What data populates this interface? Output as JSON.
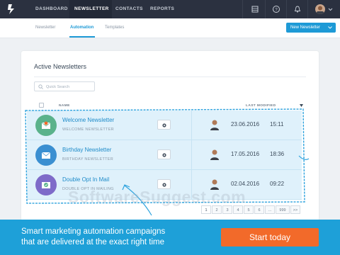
{
  "topnav": {
    "items": [
      {
        "label": "DASHBOARD"
      },
      {
        "label": "NEWSLETTER"
      },
      {
        "label": "CONTACTS"
      },
      {
        "label": "REPORTS"
      }
    ],
    "active_index": 1,
    "icons": [
      "grid-icon",
      "help-icon",
      "bell-icon",
      "avatar",
      "chevron-down-icon"
    ]
  },
  "subnav": {
    "items": [
      {
        "label": "Newsletter"
      },
      {
        "label": "Automation"
      },
      {
        "label": "Templates"
      }
    ],
    "active_index": 1,
    "new_button_label": "New Newsletter"
  },
  "card": {
    "title": "Active Newsletters",
    "search": {
      "placeholder": "Quick Search",
      "value": ""
    },
    "columns": {
      "name": "NAME",
      "last_modified": "LAST MODIFIED"
    },
    "rows": [
      {
        "name": "Welcome Newsletter",
        "sub": "WELCOME NEWSLETTER",
        "date": "23.06.2016",
        "time": "15:11",
        "icon_color": "#5ab28b"
      },
      {
        "name": "Birthday Newsletter",
        "sub": "BIRTHDAY NEWSLETTER",
        "date": "17.05.2016",
        "time": "18:36",
        "icon_color": "#3a8fd1"
      },
      {
        "name": "Double Opt In Mail",
        "sub": "DOUBLE OPT IN MAILING",
        "date": "02.04.2016",
        "time": "09:22",
        "icon_color": "#7e6bc9"
      }
    ],
    "pagination": [
      "1",
      "2",
      "3",
      "4",
      "5",
      "6",
      "...",
      "999",
      ">>"
    ]
  },
  "watermark": "SoftwareSuggest.com",
  "banner": {
    "line1": "Smart marketing automation campaigns",
    "line2": "that are delivered at the exact right time",
    "cta": "Start today"
  },
  "colors": {
    "accent": "#1e9ad6",
    "nav_bg": "#2b3140",
    "cta": "#f26a2a",
    "row_highlight": "#dff1fb"
  }
}
